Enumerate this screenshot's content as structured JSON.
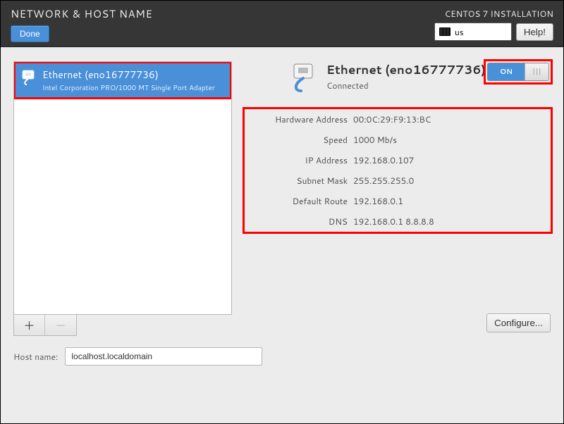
{
  "header": {
    "title": "NETWORK & HOST NAME",
    "done_label": "Done",
    "installation_label": "CENTOS 7 INSTALLATION",
    "keyboard_layout": "us",
    "help_label": "Help!"
  },
  "nic_list": {
    "items": [
      {
        "name": "Ethernet (eno16777736)",
        "description": "Intel Corporation PRO/1000 MT Single Port Adapter"
      }
    ]
  },
  "list_buttons": {
    "add": "＋",
    "remove": "－"
  },
  "selected": {
    "title": "Ethernet (eno16777736)",
    "status": "Connected",
    "toggle_on_label": "ON"
  },
  "details": {
    "hw_label": "Hardware Address",
    "hw_val": "00:0C:29:F9:13:BC",
    "speed_label": "Speed",
    "speed_val": "1000 Mb/s",
    "ip_label": "IP Address",
    "ip_val": "192.168.0.107",
    "mask_label": "Subnet Mask",
    "mask_val": "255.255.255.0",
    "route_label": "Default Route",
    "route_val": "192.168.0.1",
    "dns_label": "DNS",
    "dns_val": "192.168.0.1 8.8.8.8"
  },
  "configure_label": "Configure...",
  "hostname": {
    "label": "Host name:",
    "value": "localhost.localdomain"
  }
}
